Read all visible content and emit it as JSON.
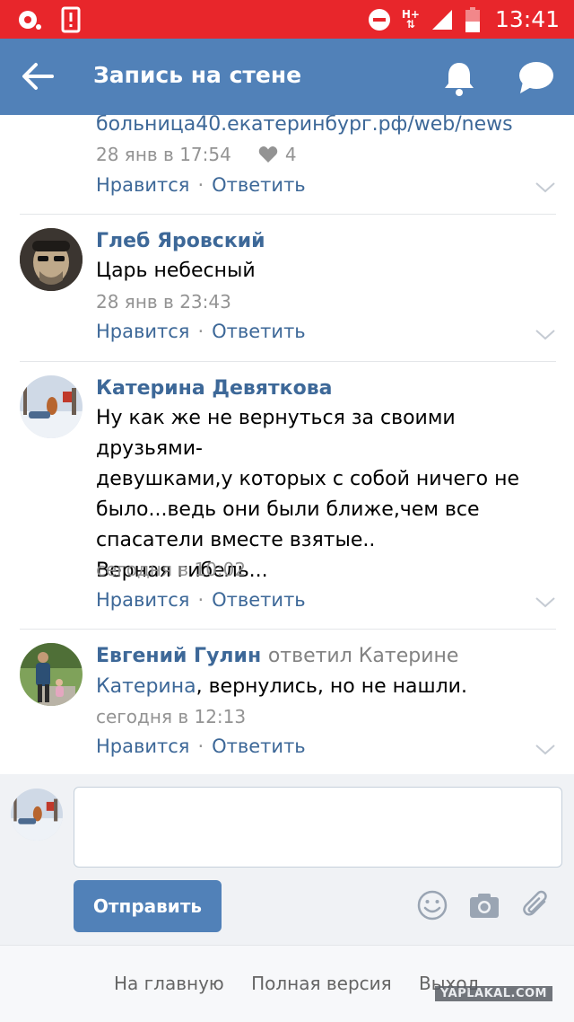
{
  "status_bar": {
    "time": "13:41",
    "network": "H+",
    "icons": [
      "record-icon",
      "alert-icon",
      "do-not-disturb-icon",
      "signal-icon",
      "battery-icon"
    ]
  },
  "header": {
    "title": "Запись на стене",
    "back_icon": "arrow-left-icon",
    "notifications_icon": "bell-icon",
    "messages_icon": "chat-bubble-icon",
    "background": "#5181b8"
  },
  "comments": [
    {
      "text_link": "больница40.екатеринбург.рф/web/news",
      "date": "28 янв в 17:54",
      "likes": "4",
      "like_label": "Нравится",
      "reply_label": "Ответить"
    },
    {
      "author": "Глеб Яровский",
      "text": "Царь небесный",
      "date": "28 янв в 23:43",
      "like_label": "Нравится",
      "reply_label": "Ответить"
    },
    {
      "author": "Катерина Девяткова",
      "text_lines": [
        "Ну как же не вернуться за своими друзьями-",
        "девушками,у которых с собой ничего не",
        "было...ведь они были ближе,чем все",
        "спасатели вместе взятые..",
        "Верная гибель..."
      ],
      "date": "сегодня в 10:02",
      "like_label": "Нравится",
      "reply_label": "Ответить"
    },
    {
      "author": "Евгений Гулин",
      "reply_to": "ответил Катерине",
      "mention": "Катерина",
      "text": ", вернулись, но не нашли.",
      "date": "сегодня в 12:13",
      "like_label": "Нравится",
      "reply_label": "Ответить"
    }
  ],
  "composer": {
    "placeholder": "",
    "send_label": "Отправить",
    "icons": [
      "emoji-icon",
      "camera-icon",
      "attachment-icon"
    ]
  },
  "footer": {
    "links": [
      "На главную",
      "Полная версия",
      "Выход"
    ]
  },
  "watermark": "YAPLAKAL.COM",
  "colors": {
    "accent": "#5181b8",
    "link": "#3d6898",
    "status_bar": "#e8262b",
    "muted": "#939393"
  }
}
